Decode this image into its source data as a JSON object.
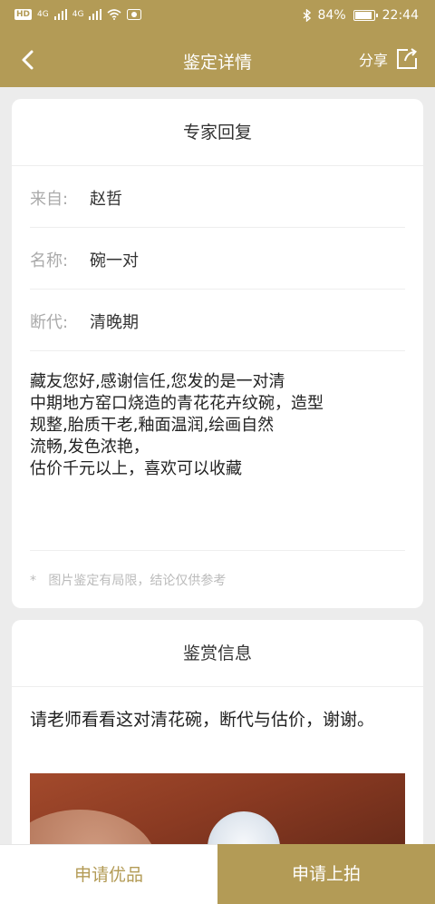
{
  "status_bar": {
    "hd": "HD",
    "net1": "4G",
    "net2": "4G",
    "battery_percent": "84%",
    "time": "22:44",
    "battery_level": 0.84
  },
  "header": {
    "title": "鉴定详情",
    "share_label": "分享",
    "back_icon": "chevron-left-icon",
    "share_icon": "share-icon"
  },
  "expert_reply": {
    "title": "专家回复",
    "fields": [
      {
        "label": "来自:",
        "value": "赵哲"
      },
      {
        "label": "名称:",
        "value": "碗一对"
      },
      {
        "label": "断代:",
        "value": "清晚期"
      }
    ],
    "reply_text": "藏友您好,感谢信任,您发的是一对清\n中期地方窑口烧造的青花花卉纹碗，造型\n规整,胎质干老,釉面温润,绘画自然\n流畅,发色浓艳，\n估价千元以上，喜欢可以收藏",
    "note_star": "*",
    "note": "图片鉴定有局限，结论仅供参考"
  },
  "appraisal_info": {
    "title": "鉴赏信息",
    "question": "请老师看看这对清花碗，断代与估价，谢谢。"
  },
  "bottom_bar": {
    "apply_premium": "申请优品",
    "apply_auction": "申请上拍"
  },
  "colors": {
    "brand": "#b39b56",
    "background": "#ececec"
  }
}
